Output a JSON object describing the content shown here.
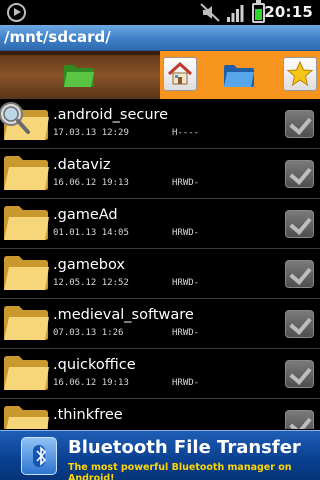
{
  "status_bar": {
    "time": "20:15"
  },
  "path": "/mnt/sdcard/",
  "files": [
    {
      "name": ".android_secure",
      "date": "17.03.13 12:29",
      "perm": "H----"
    },
    {
      "name": ".dataviz",
      "date": "16.06.12 19:13",
      "perm": "HRWD-"
    },
    {
      "name": ".gameAd",
      "date": "01.01.13 14:05",
      "perm": "HRWD-"
    },
    {
      "name": ".gamebox",
      "date": "12.05.12 12:52",
      "perm": "HRWD-"
    },
    {
      "name": ".medieval_software",
      "date": "07.03.13 1:26",
      "perm": "HRWD-"
    },
    {
      "name": ".quickoffice",
      "date": "16.06.12 19:13",
      "perm": "HRWD-"
    },
    {
      "name": ".thinkfree",
      "date": "",
      "perm": ""
    }
  ],
  "ad": {
    "title": "Bluetooth File Transfer",
    "subtitle": "The most powerful Bluetooth manager on Android!"
  },
  "colors": {
    "path_bar": "#3f7fc7",
    "toolbar_orange": "#f7941d",
    "folder_yellow": "#f7d67a",
    "checkbox_gray": "#5f5f5f"
  },
  "icons": {
    "status_left": "play-circle-icon",
    "mute": "mute-icon",
    "signal": "signal-icon",
    "battery": "battery-icon",
    "toolbar_left": "green-folder-icon",
    "home": "home-icon",
    "toolbar_mid": "blue-folder-icon",
    "star": "star-icon",
    "row": "folder-icon",
    "search": "magnifier-icon",
    "ad": "bluetooth-icon"
  }
}
